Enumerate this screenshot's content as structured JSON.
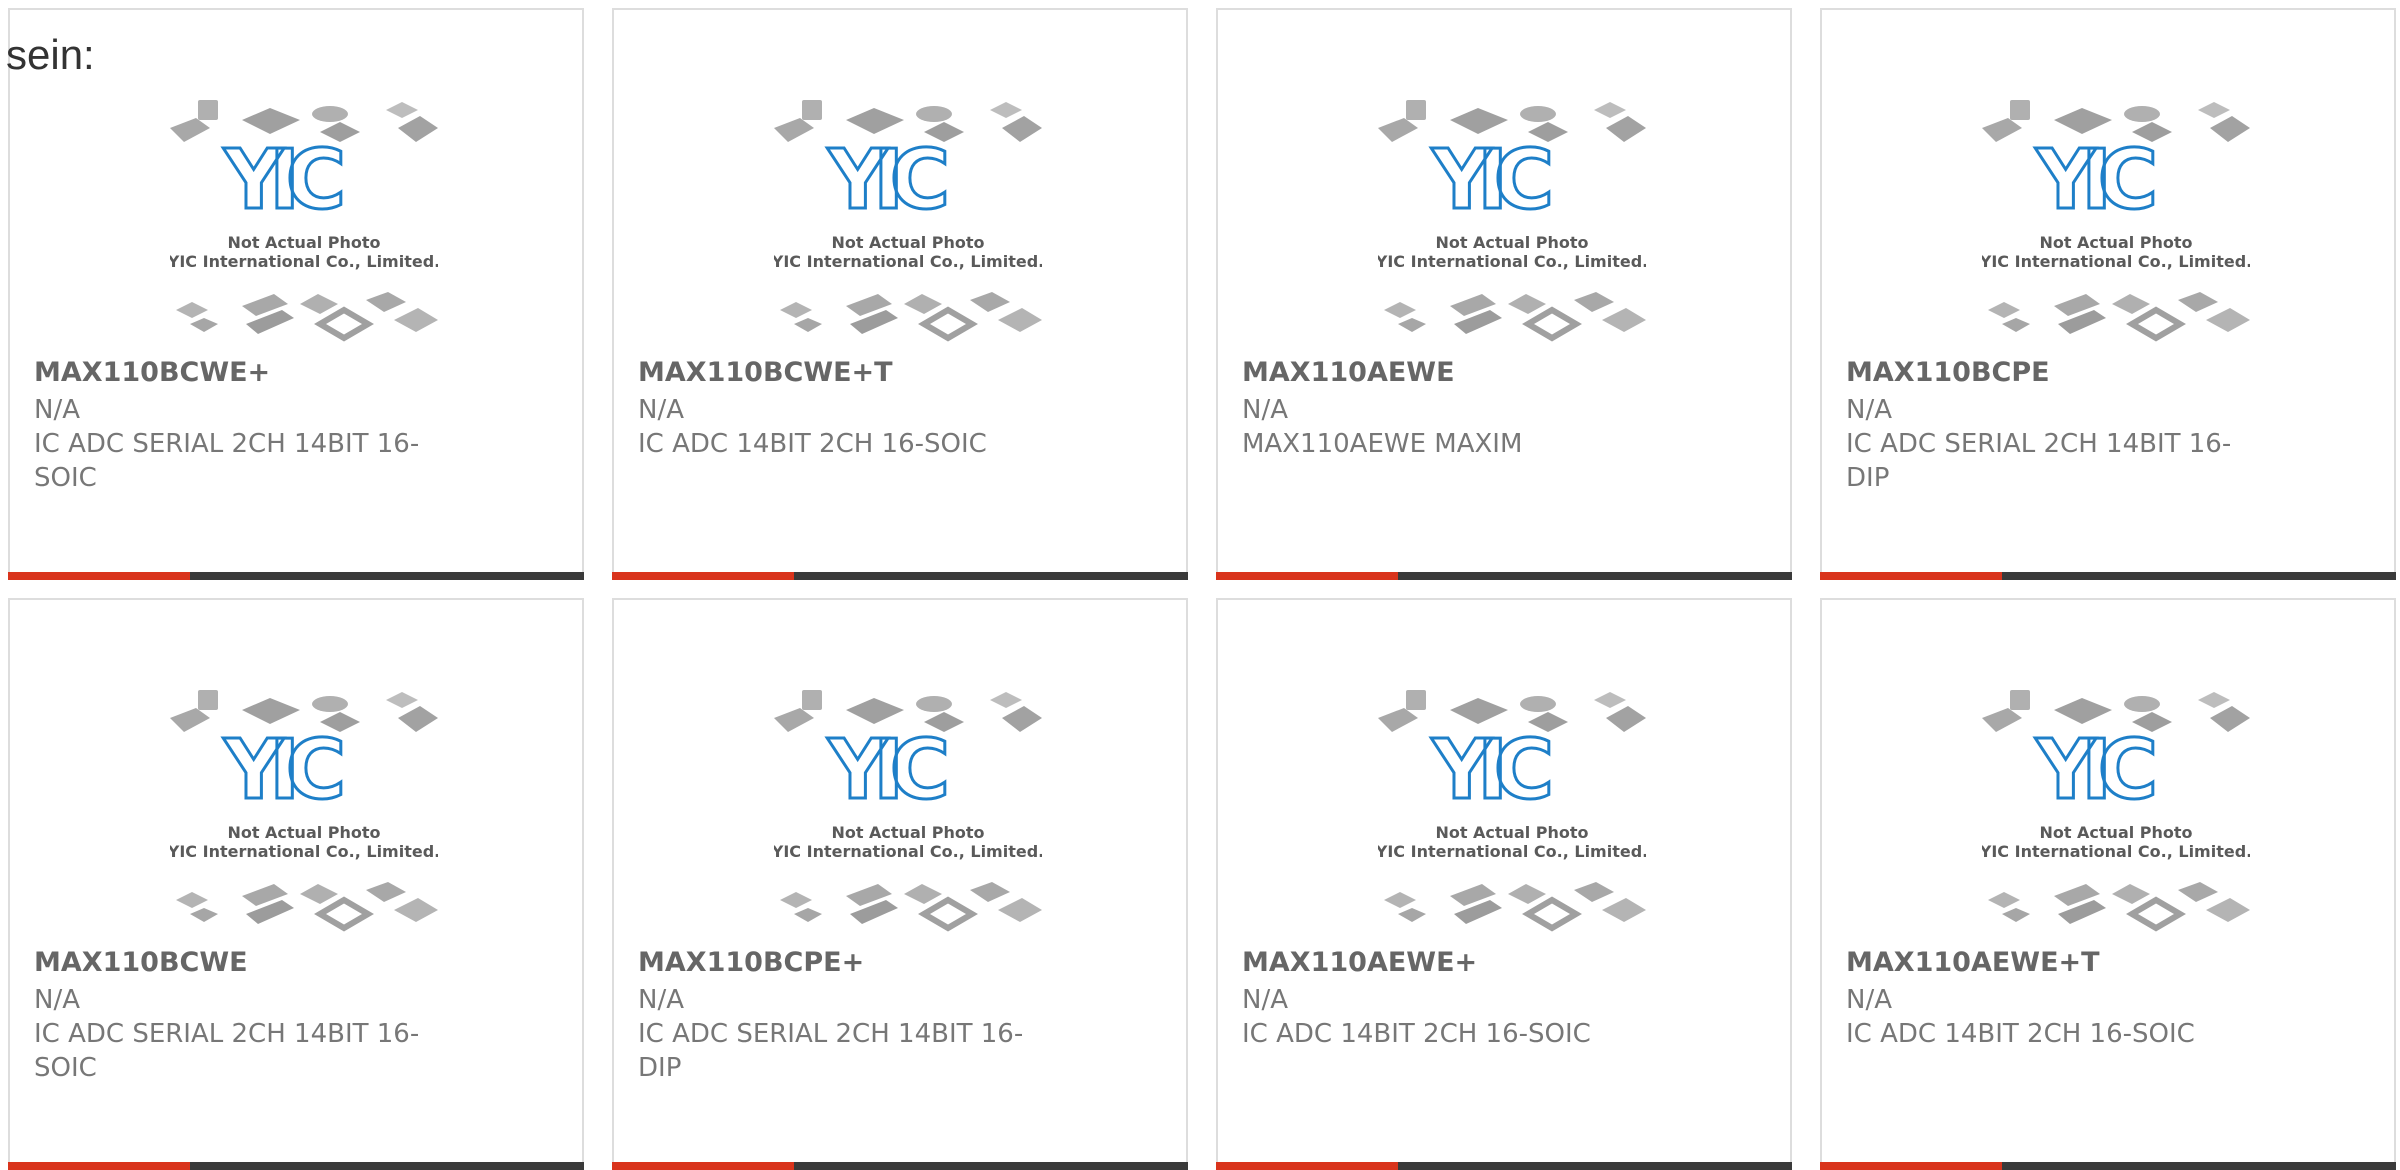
{
  "header": {
    "lead_text": "sein:"
  },
  "placeholder": {
    "logo": "YIC",
    "caption_line1": "Not Actual Photo",
    "caption_line2": "YIC International Co., Limited."
  },
  "colors": {
    "accent": "#d9341c",
    "bar": "#3a3a3a",
    "logo_blue": "#1e7fc8",
    "text": "#777777"
  },
  "products": [
    {
      "part_number": "MAX110BCWE+",
      "manufacturer": "N/A",
      "description": "IC ADC SERIAL 2CH 14BIT 16-SOIC"
    },
    {
      "part_number": "MAX110BCWE+T",
      "manufacturer": "N/A",
      "description": "IC ADC 14BIT 2CH 16-SOIC"
    },
    {
      "part_number": "MAX110AEWE",
      "manufacturer": "N/A",
      "description": "MAX110AEWE MAXIM"
    },
    {
      "part_number": "MAX110BCPE",
      "manufacturer": "N/A",
      "description": "IC ADC SERIAL 2CH 14BIT 16-DIP"
    },
    {
      "part_number": "MAX110BCWE",
      "manufacturer": "N/A",
      "description": "IC ADC SERIAL 2CH 14BIT 16-SOIC"
    },
    {
      "part_number": "MAX110BCPE+",
      "manufacturer": "N/A",
      "description": "IC ADC SERIAL 2CH 14BIT 16-DIP"
    },
    {
      "part_number": "MAX110AEWE+",
      "manufacturer": "N/A",
      "description": "IC ADC 14BIT 2CH 16-SOIC"
    },
    {
      "part_number": "MAX110AEWE+T",
      "manufacturer": "N/A",
      "description": "IC ADC 14BIT 2CH 16-SOIC"
    }
  ]
}
